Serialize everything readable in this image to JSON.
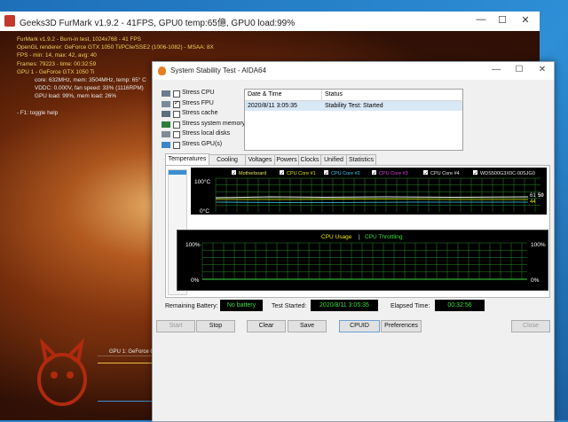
{
  "furmark": {
    "title": "Geeks3D FurMark v1.9.2 - 41FPS, GPU0 temp:65億, GPU0 load:99%",
    "controls": {
      "minimize": "—",
      "maximize": "☐",
      "close": "✕"
    },
    "info": [
      {
        "text": "FurMark v1.9.2 - Burn-in test, 1024x768 - 41 FPS",
        "style": "y"
      },
      {
        "text": "OpenGL renderer: GeForce GTX 1050 Ti/PCIe/SSE2 (1006-1082) - MSAA: 8X",
        "style": "y"
      },
      {
        "text": "FPS - min: 14, max: 42, avg: 40",
        "style": "y"
      },
      {
        "text": "Frames: 79223 - time: 00:32:59",
        "style": "y"
      },
      {
        "text": "GPU 1 - GeForce GTX 1050 Ti",
        "style": "y"
      },
      {
        "text": "core: 632MHz, mem: 3504MHz, temp: 65° C",
        "style": "w",
        "indent": true
      },
      {
        "text": "VDDC: 0.000V, fan speed: 33% (1116RPM)",
        "style": "w",
        "indent": true
      },
      {
        "text": "GPU load: 99%, mem load: 26%",
        "style": "w",
        "indent": true
      },
      {
        "text": "",
        "style": "w"
      },
      {
        "text": "- F1: toggle help",
        "style": "w"
      }
    ],
    "bottom_label": "GPU 1: GeForce GTX 1050 Ti - cur:65° C - min:44° C - max:66° C"
  },
  "aida": {
    "title": "System Stability Test - AIDA64",
    "controls": {
      "minimize": "—",
      "maximize": "☐",
      "close": "✕"
    },
    "options": [
      {
        "label": "Stress CPU",
        "checked": false,
        "icon": "cpu-icon"
      },
      {
        "label": "Stress FPU",
        "checked": true,
        "icon": "fpu-icon"
      },
      {
        "label": "Stress cache",
        "checked": false,
        "icon": "cache-icon"
      },
      {
        "label": "Stress system memory",
        "checked": false,
        "icon": "memory-icon"
      },
      {
        "label": "Stress local disks",
        "checked": false,
        "icon": "disk-icon"
      },
      {
        "label": "Stress GPU(s)",
        "checked": false,
        "icon": "gpu-icon"
      }
    ],
    "log": {
      "headers": [
        "Date & Time",
        "Status"
      ],
      "rows": [
        [
          "2020/8/11 3:05:35",
          "Stability Test: Started"
        ]
      ]
    },
    "tabs": [
      "Temperatures",
      "Cooling Fans",
      "Voltages",
      "Powers",
      "Clocks",
      "Unified",
      "Statistics"
    ],
    "active_tab": "Temperatures",
    "temp_legend": [
      {
        "label": "Motherboard",
        "color": "#e8e860",
        "checked": true
      },
      {
        "label": "CPU Core #1",
        "color": "#e8e800",
        "checked": true
      },
      {
        "label": "CPU Core #2",
        "color": "#40d0f0",
        "checked": true
      },
      {
        "label": "CPU Core #3",
        "color": "#e040e0",
        "checked": true
      },
      {
        "label": "CPU Core #4",
        "color": "#e8e8e8",
        "checked": true
      },
      {
        "label": "WDS500G3X0C-00SJG0",
        "color": "#e8e8e8",
        "checked": true
      }
    ],
    "temp_axis": {
      "top": "100°C",
      "bottom": "0°C"
    },
    "temp_values": {
      "a": "61",
      "b": "50",
      "c": "44"
    },
    "usage_title": {
      "cpu": "CPU Usage",
      "sep": "|",
      "throttle": "CPU Throttling"
    },
    "usage_axis": {
      "top_left": "100%",
      "bottom_left": "0%",
      "top_right": "100%",
      "bottom_right": "0%"
    },
    "status": {
      "battery_label": "Remaining Battery:",
      "battery_value": "No battery",
      "started_label": "Test Started:",
      "started_value": "2020/8/11 3:05:35",
      "elapsed_label": "Elapsed Time:",
      "elapsed_value": "00:32:56"
    },
    "buttons": {
      "start": "Start",
      "stop": "Stop",
      "clear": "Clear",
      "save": "Save",
      "cpuid": "CPUID",
      "preferences": "Preferences",
      "close": "Close"
    },
    "colors": {
      "graph_green": "#2b8a2b",
      "graph_value": "#3ddc3d"
    }
  }
}
